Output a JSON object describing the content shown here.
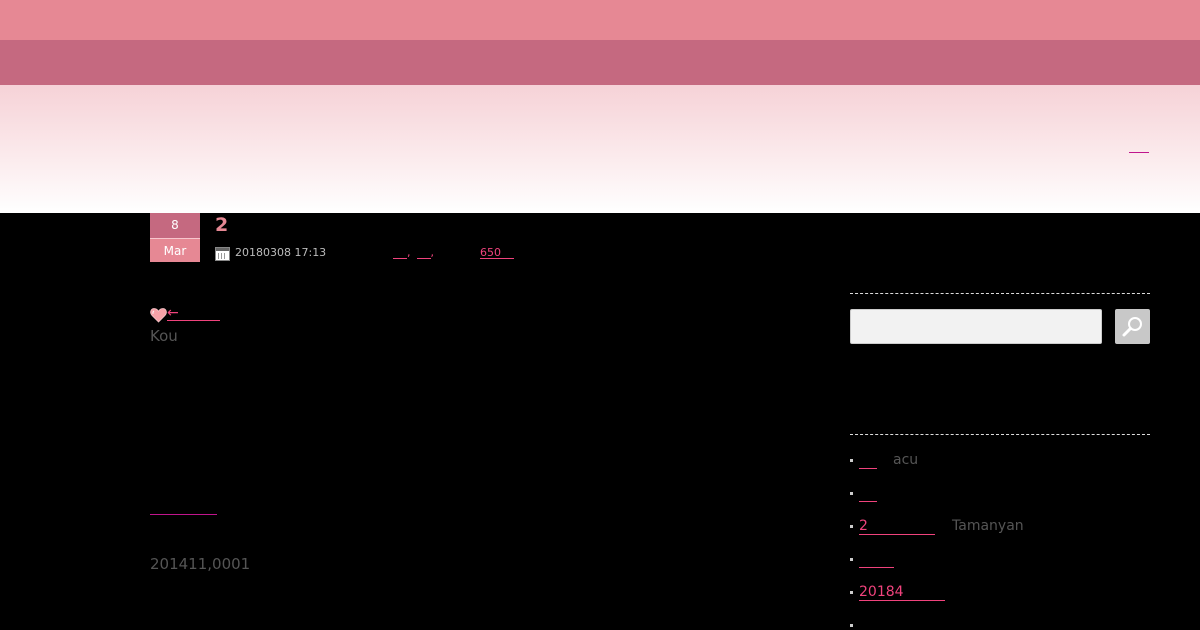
{
  "post": {
    "date_day": "8",
    "date_month": "Mar",
    "title": "2",
    "datetime": "20180308 17:13",
    "meta_separator_1": ",",
    "meta_separator_2": ",",
    "view_count": "650",
    "author": "Kou",
    "back_arrow": "←",
    "code": "201411,0001"
  },
  "sidebar": {
    "recent_comments": [
      {
        "link": "",
        "author": "acu"
      },
      {
        "link": "",
        "author": ""
      },
      {
        "link": "2",
        "author": "Tamanyan"
      },
      {
        "link": "",
        "author": ""
      },
      {
        "link": "20184",
        "author": ""
      }
    ]
  },
  "colors": {
    "accent": "#f0437d",
    "title_pink": "#e68894",
    "header_dark": "#c56980"
  },
  "icons": {
    "calendar": "calendar-icon",
    "heart": "heart-icon",
    "search": "search-icon"
  }
}
